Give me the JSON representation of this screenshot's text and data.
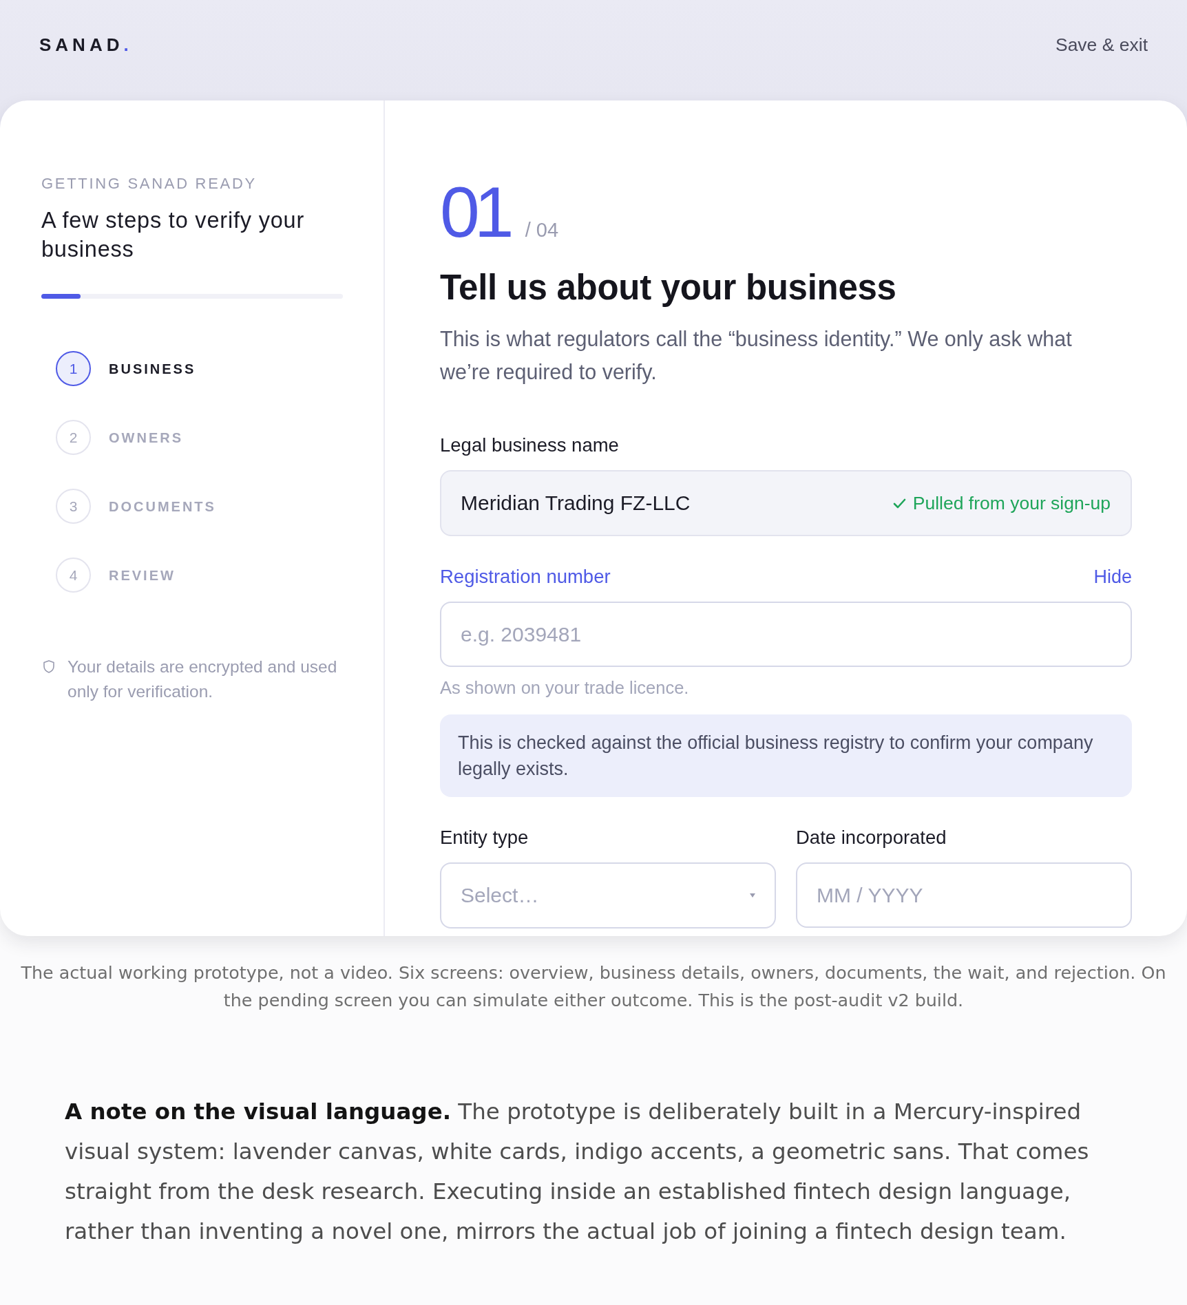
{
  "header": {
    "logo": {
      "text": "SANAD",
      "accent": "."
    },
    "save_exit": "Save & exit"
  },
  "sidebar": {
    "eyebrow": "GETTING SANAD READY",
    "title": "A few steps to verify your business",
    "progress": {
      "level": 0.13
    },
    "steps": [
      {
        "number": "1",
        "label": "BUSINESS",
        "selected": true
      },
      {
        "number": "2",
        "label": "OWNERS",
        "selected": false
      },
      {
        "number": "3",
        "label": "DOCUMENTS",
        "selected": false
      },
      {
        "number": "4",
        "label": "REVIEW",
        "selected": false
      }
    ],
    "security_note": "Your details are encrypted and used only for verification."
  },
  "main": {
    "step_number": "01",
    "step_total": "/ 04",
    "heading": "Tell us about your business",
    "description": "This is what regulators call the “business identity.” We only ask what we’re required to verify.",
    "fields": [
      {
        "kind": "prefilled",
        "label": "Legal business name",
        "value": "Meridian Trading FZ-LLC",
        "source": "Pulled from your sign-up"
      },
      {
        "kind": "text",
        "label": "Registration number",
        "expanded": true,
        "action": "Hide",
        "placeholder": "e.g. 2039481",
        "hint": "As shown on your trade licence.",
        "info": "This is checked against the official business registry to confirm your company legally exists."
      }
    ],
    "field_row": [
      {
        "kind": "select",
        "label": "Entity type",
        "placeholder": "Select…"
      },
      {
        "kind": "text",
        "label": "Date incorporated",
        "placeholder": "MM / YYYY"
      }
    ]
  },
  "caption": "The actual working prototype, not a video. Six screens: overview, business details, owners, documents, the wait, and rejection. On the pending screen you can simulate either outcome. This is the post-audit v2 build.",
  "note": "**A note on the visual language.** The prototype is deliberately built in a Mercury-inspired visual system: lavender canvas, white cards, indigo accents, a geometric sans. That comes straight from the desk research. Executing inside an established fintech design language, rather than inventing a novel one, mirrors the actual job of joining a fintech design team."
}
